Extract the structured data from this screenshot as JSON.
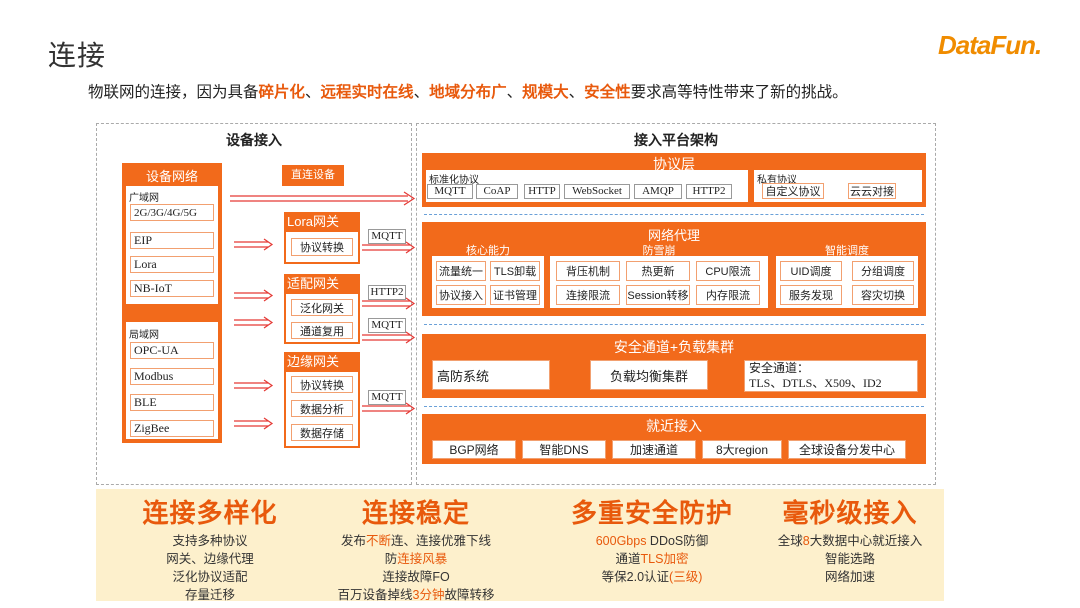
{
  "title": "连接",
  "logo": "DataFun.",
  "subtitle": {
    "prefix": "物联网的连接，因为具备",
    "h1": "碎片化",
    "sep1": "、",
    "h2": "远程实时在线",
    "sep2": "、",
    "h3": "地域分布广",
    "sep3": "、",
    "h4": "规模大",
    "sep4": "、",
    "h5": "安全性",
    "suffix": "要求高等特性带来了新的挑战。"
  },
  "left_panel": {
    "title": "设备接入",
    "device_network": {
      "title": "设备网络",
      "wan_label": "广域网",
      "wan_items": [
        "2G/3G/4G/5G",
        "EIP",
        "Lora",
        "NB-IoT"
      ],
      "lan_label": "局域网",
      "lan_items": [
        "OPC-UA",
        "Modbus",
        "BLE",
        "ZigBee"
      ]
    },
    "direct_device": "直连设备",
    "lora_gateway": {
      "title": "Lora网关",
      "items": [
        "协议转换"
      ]
    },
    "adapter_gateway": {
      "title": "适配网关",
      "items": [
        "泛化网关",
        "通道复用"
      ]
    },
    "edge_gateway": {
      "title": "边缘网关",
      "items": [
        "协议转换",
        "数据分析",
        "数据存储"
      ]
    },
    "protocols": [
      "MQTT",
      "HTTP2",
      "MQTT",
      "MQTT"
    ]
  },
  "right_panel": {
    "title": "接入平台架构",
    "protocol_layer": {
      "title": "协议层",
      "std_label": "标准化协议",
      "std_items": [
        "MQTT",
        "CoAP",
        "HTTP",
        "WebSocket",
        "AMQP",
        "HTTP2"
      ],
      "private_label": "私有协议",
      "private_items": [
        "自定义协议",
        "云云对接"
      ]
    },
    "network_proxy": {
      "title": "网络代理",
      "core": {
        "label": "核心能力",
        "items": [
          "流量统一",
          "TLS卸载",
          "协议接入",
          "证书管理"
        ]
      },
      "avalanche": {
        "label": "防雪崩",
        "items": [
          "背压机制",
          "热更新",
          "CPU限流",
          "连接限流",
          "Session转移",
          "内存限流"
        ]
      },
      "scheduling": {
        "label": "智能调度",
        "items": [
          "UID调度",
          "分组调度",
          "服务发现",
          "容灾切换"
        ]
      }
    },
    "security": {
      "title": "安全通道+负载集群",
      "items": [
        "高防系统",
        "负载均衡集群"
      ],
      "channel_label": "安全通道：",
      "channel_value": "TLS、DTLS、X509、ID2"
    },
    "nearby": {
      "title": "就近接入",
      "items": [
        "BGP网络",
        "智能DNS",
        "加速通道",
        "8大region",
        "全球设备分发中心"
      ]
    }
  },
  "features": [
    {
      "title": "连接多样化",
      "lines": [
        [
          {
            "t": "支持多种协议"
          }
        ],
        [
          {
            "t": "网关、边缘代理"
          }
        ],
        [
          {
            "t": "泛化协议适配"
          }
        ],
        [
          {
            "t": "存量迁移"
          }
        ]
      ]
    },
    {
      "title": "连接稳定",
      "lines": [
        [
          {
            "t": "发布"
          },
          {
            "t": "不断",
            "hl": true
          },
          {
            "t": "连、连接优雅下线"
          }
        ],
        [
          {
            "t": "防"
          },
          {
            "t": "连接风暴",
            "hl": true
          }
        ],
        [
          {
            "t": "连接故障FO"
          }
        ],
        [
          {
            "t": "百万设备掉线"
          },
          {
            "t": "3分钟",
            "hl": true
          },
          {
            "t": "故障转移"
          }
        ]
      ]
    },
    {
      "title": "多重安全防护",
      "lines": [
        [
          {
            "t": "600Gbps",
            "hl": true
          },
          {
            "t": " DDoS防御"
          }
        ],
        [
          {
            "t": "通道"
          },
          {
            "t": "TLS加密",
            "hl": true
          }
        ],
        [
          {
            "t": "等保2.0认证"
          },
          {
            "t": "(三级)",
            "hl": true
          }
        ]
      ]
    },
    {
      "title": "毫秒级接入",
      "lines": [
        [
          {
            "t": "全球"
          },
          {
            "t": "8",
            "hl": true
          },
          {
            "t": "大数据中心就近接入"
          }
        ],
        [
          {
            "t": "智能选路"
          }
        ],
        [
          {
            "t": "网络加速"
          }
        ]
      ]
    }
  ],
  "colors": {
    "accent": "#f26a1b",
    "highlight": "#e8590c",
    "features_bg": "#fdf0cc"
  }
}
